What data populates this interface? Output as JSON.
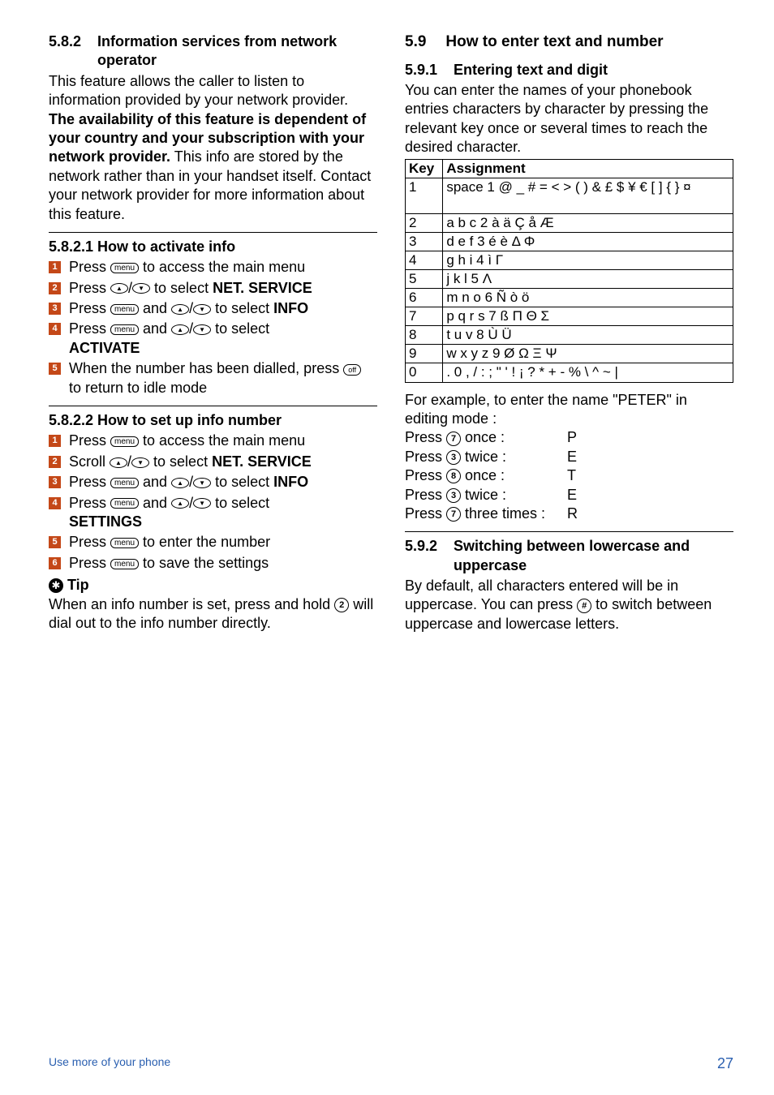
{
  "left": {
    "h582": {
      "num": "5.8.2",
      "title": "Information services from network operator"
    },
    "intro": "This feature allows the caller to listen to information provided by your network provider.",
    "bold_para": "The availability of this feature is dependent of your country and your subscription with your network provider.",
    "after_bold": " This info are stored by the network rather than in your handset itself. Contact your network provider for more information about this feature.",
    "h5821": "5.8.2.1  How to activate info",
    "s5821": {
      "1": {
        "a": "Press ",
        "b": " to access the main menu"
      },
      "2": {
        "a": "Press ",
        "b": " to select ",
        "c": "NET. SERVICE"
      },
      "3": {
        "a": "Press ",
        "b": " and ",
        "c": " to select ",
        "d": "INFO"
      },
      "4": {
        "a": "Press ",
        "b": " and ",
        "c": " to select",
        "d": "ACTIVATE"
      },
      "5": {
        "a": "When the number has been dialled, press ",
        "b": " to return to idle mode"
      }
    },
    "h5822": "5.8.2.2  How to set up info number",
    "s5822": {
      "1": {
        "a": "Press ",
        "b": " to access the main menu"
      },
      "2": {
        "a": "Scroll ",
        "b": " to select ",
        "c": "NET. SERVICE"
      },
      "3": {
        "a": "Press ",
        "b": " and ",
        "c": " to select ",
        "d": "INFO"
      },
      "4": {
        "a": "Press ",
        "b": " and ",
        "c": " to select",
        "d": "SETTINGS"
      },
      "5": {
        "a": "Press ",
        "b": " to enter the number"
      },
      "6": {
        "a": "Press ",
        "b": " to save the settings"
      }
    },
    "tip_label": "Tip",
    "tip_text_a": "When an info number is set, press and hold ",
    "tip_text_b": " will dial out to the info number directly."
  },
  "right": {
    "h59": {
      "num": "5.9",
      "title": "How to enter text and number"
    },
    "h591": {
      "num": "5.9.1",
      "title": "Entering text and digit"
    },
    "p591": "You can enter the names of your phonebook entries characters by character by pressing the relevant key once or several times to reach the desired character.",
    "table": {
      "head": {
        "k": "Key",
        "a": "Assignment"
      },
      "rows": [
        {
          "k": "1",
          "a": "space 1 @ _ # = < > ( ) & £ $ ¥ € [ ] { } ¤"
        },
        {
          "k": "2",
          "a": "a b c 2 à ä Ç å Æ"
        },
        {
          "k": "3",
          "a": "d e f 3 é è Δ Φ"
        },
        {
          "k": "4",
          "a": "g h i 4 ì Γ"
        },
        {
          "k": "5",
          "a": "j k l 5 Λ"
        },
        {
          "k": "6",
          "a": "m n o 6 Ñ ò ö"
        },
        {
          "k": "7",
          "a": "p q r s 7 ß Π Θ Σ"
        },
        {
          "k": "8",
          "a": "t u v 8 Ù Ü"
        },
        {
          "k": "9",
          "a": "w x y z 9 Ø Ω Ξ Ψ"
        },
        {
          "k": "0",
          "a": ". 0 , / : ; \" ' ! ¡ ? * + - % \\ ^ ~ |"
        }
      ]
    },
    "example_intro": "For example, to enter the name \"PETER\" in editing mode :",
    "ex": [
      {
        "a": "Press ",
        "key": "7",
        "b": " once :",
        "r": "P"
      },
      {
        "a": "Press ",
        "key": "3",
        "b": " twice :",
        "r": "E"
      },
      {
        "a": "Press ",
        "key": "8",
        "b": " once :",
        "r": "T"
      },
      {
        "a": "Press ",
        "key": "3",
        "b": " twice :",
        "r": "E"
      },
      {
        "a": "Press ",
        "key": "7",
        "b": " three times :",
        "r": "R"
      }
    ],
    "h592": {
      "num": "5.9.2",
      "title": "Switching between lowercase and uppercase"
    },
    "p592a": "By default, all characters entered will be in uppercase. You can press ",
    "p592b": " to switch between uppercase and lowercase letters."
  },
  "icons": {
    "menu": "menu",
    "up": "▲",
    "down": "▼",
    "off": "off",
    "hash": "#",
    "two": "2",
    "three": "3",
    "seven": "7",
    "eight": "8"
  },
  "footer": {
    "left": "Use more of your phone",
    "right": "27"
  }
}
